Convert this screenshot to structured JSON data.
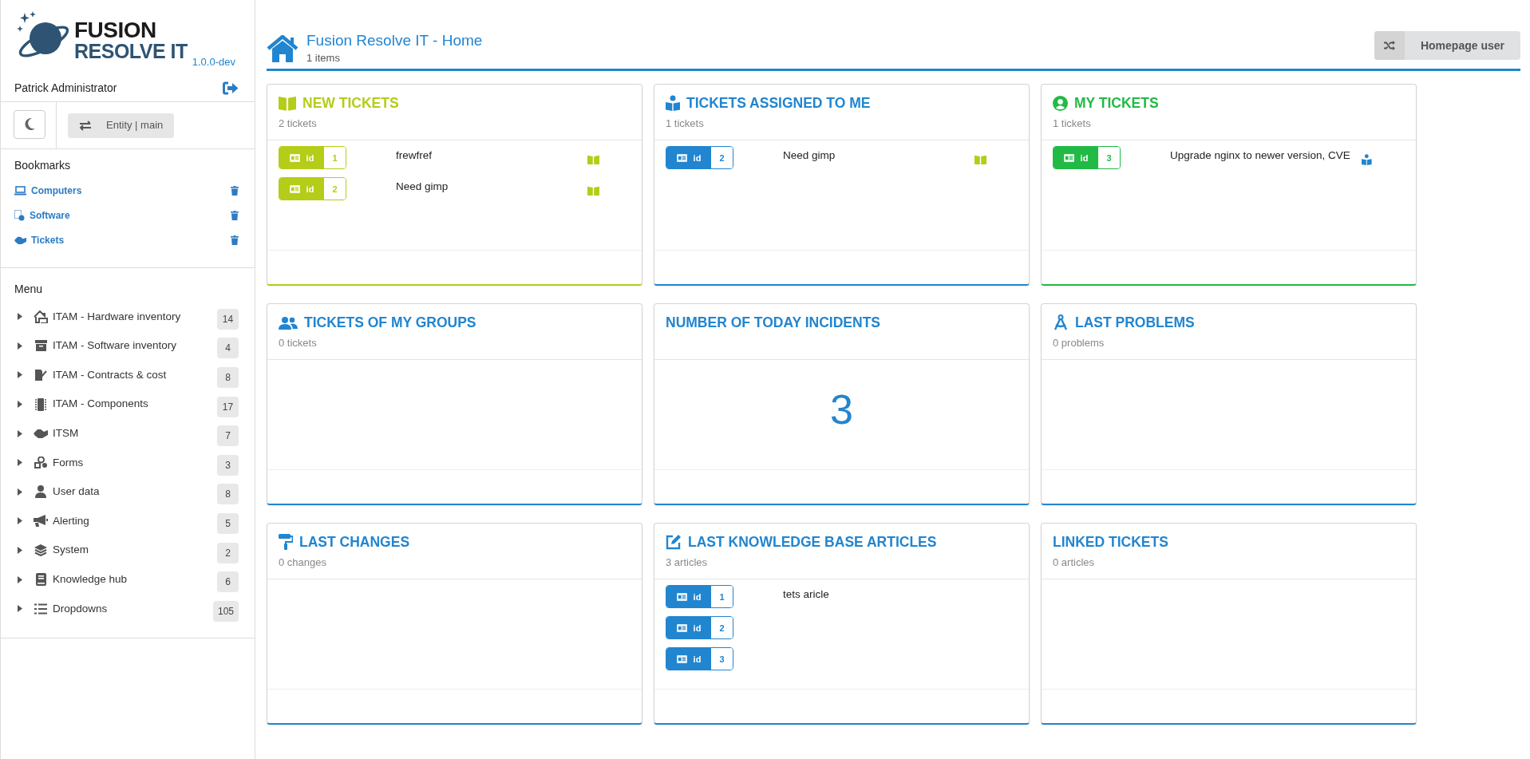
{
  "sidebar": {
    "logo": {
      "line_1": "FUSION",
      "line_2": "RESOLVE IT"
    },
    "version": "1.0.0-dev",
    "user": "Patrick Administrator",
    "entity_button": "Entity | main",
    "bookmarks": {
      "title": "Bookmarks",
      "items": [
        {
          "label": "Computers"
        },
        {
          "label": "Software"
        },
        {
          "label": "Tickets"
        }
      ]
    },
    "menu": {
      "title": "Menu",
      "items": [
        {
          "label": "ITAM - Hardware inventory",
          "count": "14",
          "expanded": false
        },
        {
          "label": "ITAM - Software inventory",
          "count": "4",
          "expanded": false
        },
        {
          "label": "ITAM - Contracts & cost",
          "count": "8",
          "expanded": false
        },
        {
          "label": "ITAM - Components",
          "count": "17",
          "expanded": false
        },
        {
          "label": "ITSM",
          "count": "7",
          "expanded": false
        },
        {
          "label": "Forms",
          "count": "3",
          "expanded": false
        },
        {
          "label": "User data",
          "count": "8",
          "expanded": false
        },
        {
          "label": "Alerting",
          "count": "5",
          "expanded": false
        },
        {
          "label": "System",
          "count": "2",
          "expanded": false
        },
        {
          "label": "Knowledge hub",
          "count": "6",
          "expanded": false
        },
        {
          "label": "Dropdowns",
          "count": "105",
          "expanded": false
        }
      ]
    }
  },
  "header": {
    "title": "Fusion Resolve IT - Home",
    "subtitle": "1 items",
    "button": "Homepage user"
  },
  "widgets": [
    {
      "title": "NEW TICKETS",
      "subtitle": "2 tickets",
      "color": "#b5cc18",
      "rows": [
        {
          "badge_label": "id",
          "id": "1",
          "text": "frewfref",
          "kind": "new"
        },
        {
          "badge_label": "id",
          "id": "2",
          "text": "Need gimp",
          "kind": "new"
        }
      ]
    },
    {
      "title": "TICKETS ASSIGNED TO ME",
      "subtitle": "1 tickets",
      "color": "#2185d0",
      "rows": [
        {
          "badge_label": "id",
          "id": "2",
          "text": "Need gimp",
          "kind": "new"
        }
      ]
    },
    {
      "title": "MY TICKETS",
      "subtitle": "1 tickets",
      "color": "#21ba45",
      "rows": [
        {
          "badge_label": "id",
          "id": "3",
          "text": "Upgrade nginx to newer version, CVE",
          "kind": "assigned"
        }
      ]
    },
    {
      "title": "TICKETS OF MY GROUPS",
      "subtitle": "0 tickets",
      "color": "#2185d0"
    },
    {
      "title": "NUMBER OF TODAY INCIDENTS",
      "color": "#2185d0",
      "value": "3"
    },
    {
      "title": "LAST PROBLEMS",
      "subtitle": "0 problems",
      "color": "#2185d0"
    },
    {
      "title": "LAST CHANGES",
      "subtitle": "0 changes",
      "color": "#2185d0"
    },
    {
      "title": "LAST KNOWLEDGE BASE ARTICLES",
      "subtitle": "3 articles",
      "color": "#2185d0",
      "rows": [
        {
          "badge_label": "id",
          "id": "1",
          "text": "tets aricle",
          "kind": "article"
        },
        {
          "badge_label": "id",
          "id": "2",
          "kind": "article"
        },
        {
          "badge_label": "id",
          "id": "3",
          "kind": "article"
        }
      ]
    },
    {
      "title": "LINKED TICKETS",
      "subtitle": "0 articles",
      "color": "#2185d0"
    }
  ]
}
